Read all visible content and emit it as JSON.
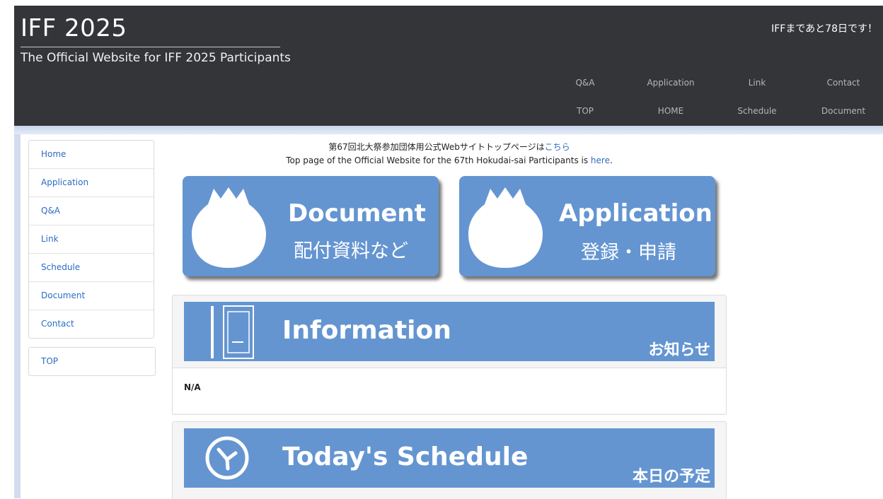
{
  "header": {
    "title": "IFF 2025",
    "subtitle": "The Official Website for IFF 2025 Participants",
    "countdown": "IFFまであと78日です！",
    "nav_row1": [
      "Q&A",
      "Application",
      "Link",
      "Contact"
    ],
    "nav_row2": [
      "TOP",
      "HOME",
      "Schedule",
      "Document"
    ]
  },
  "sidebar": {
    "items": [
      "Home",
      "Application",
      "Q&A",
      "Link",
      "Schedule",
      "Document",
      "Contact"
    ],
    "top_item": "TOP"
  },
  "main": {
    "jp_prefix": "第67回北大祭参加団体用公式Webサイトトップページは",
    "jp_link": "こちら",
    "en_prefix": "Top page of the Official Website for the 67th Hokudai-sai Participants is ",
    "en_link": "here",
    "en_suffix": ".",
    "document_button": {
      "title": "Document",
      "subtitle": "配付資料など"
    },
    "application_button": {
      "title": "Application",
      "subtitle": "登録・申請"
    },
    "information": {
      "title": "Information",
      "subtitle": "お知らせ",
      "content": "N/A"
    },
    "schedule": {
      "title": "Today's Schedule",
      "subtitle": "本日の予定"
    }
  },
  "colors": {
    "header_bg": "#333538",
    "accent_blue": "#6495d1",
    "link": "#2b6cc4"
  }
}
